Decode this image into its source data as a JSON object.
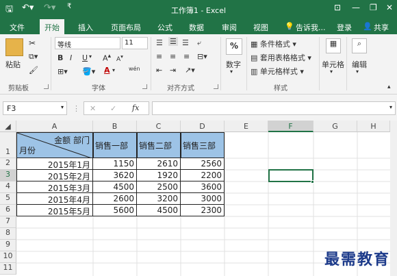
{
  "title": "工作簿1 - Excel",
  "tabs": [
    "文件",
    "开始",
    "插入",
    "页面布局",
    "公式",
    "数据",
    "审阅",
    "视图"
  ],
  "tell_me": "告诉我...",
  "login": "登录",
  "share": "共享",
  "ribbon": {
    "paste": "粘贴",
    "clipboard": "剪贴板",
    "font_name": "等线",
    "font_size": "11",
    "bold": "B",
    "italic": "I",
    "underline": "U",
    "font_group": "字体",
    "align_group": "对齐方式",
    "number": "数字",
    "number_symbol": "%",
    "cond_format": "条件格式",
    "table_format": "套用表格格式",
    "cell_style": "单元格样式",
    "style_group": "样式",
    "cells": "单元格",
    "editing": "编辑",
    "font_grow": "A",
    "font_color": "A",
    "wen": "wén"
  },
  "formula_bar": {
    "name_box": "F3",
    "fx": "fx",
    "cancel": "✕",
    "enter": "✓"
  },
  "columns": [
    "A",
    "B",
    "C",
    "D",
    "E",
    "F",
    "G",
    "H"
  ],
  "rows": [
    "1",
    "2",
    "3",
    "4",
    "5",
    "6",
    "7",
    "8",
    "9",
    "10",
    "11"
  ],
  "table": {
    "corner_top": "金额  部门",
    "corner_bottom": "月份",
    "headers": [
      "销售一部",
      "销售二部",
      "销售三部"
    ],
    "data": [
      {
        "month": "2015年1月",
        "values": [
          "1150",
          "2610",
          "2560"
        ]
      },
      {
        "month": "2015年2月",
        "values": [
          "3620",
          "1920",
          "2200"
        ]
      },
      {
        "month": "2015年3月",
        "values": [
          "4500",
          "2500",
          "3600"
        ]
      },
      {
        "month": "2015年4月",
        "values": [
          "2600",
          "3200",
          "3000"
        ]
      },
      {
        "month": "2015年5月",
        "values": [
          "5600",
          "4500",
          "2300"
        ]
      }
    ]
  },
  "watermark": "最需教育"
}
